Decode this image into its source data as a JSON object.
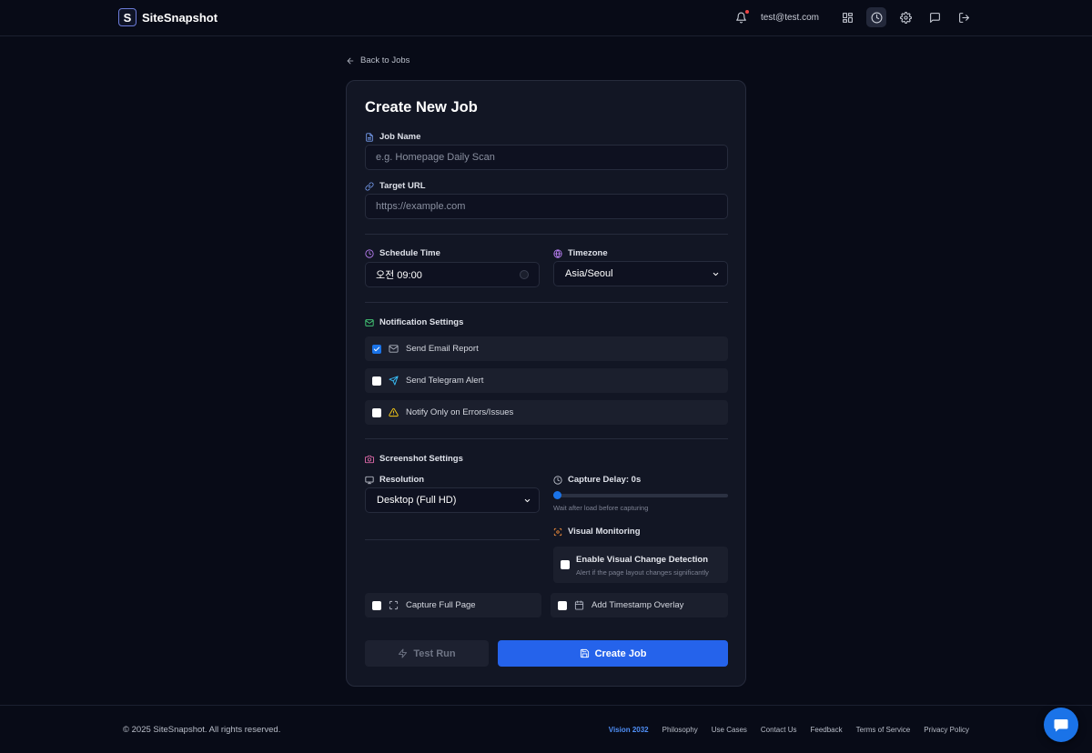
{
  "header": {
    "brand_letter": "S",
    "brand_name": "SiteSnapshot",
    "user_email": "test@test.com"
  },
  "back_link": "Back to Jobs",
  "form": {
    "title": "Create New Job",
    "job_name": {
      "label": "Job Name",
      "placeholder": "e.g. Homepage Daily Scan"
    },
    "target_url": {
      "label": "Target URL",
      "placeholder": "https://example.com"
    },
    "schedule_time": {
      "label": "Schedule Time",
      "value": "오전 09:00"
    },
    "timezone": {
      "label": "Timezone",
      "value": "Asia/Seoul"
    },
    "notifications": {
      "label": "Notification Settings",
      "options": [
        {
          "label": "Send Email Report",
          "checked": true
        },
        {
          "label": "Send Telegram Alert",
          "checked": false
        },
        {
          "label": "Notify Only on Errors/Issues",
          "checked": false
        }
      ]
    },
    "screenshot": {
      "label": "Screenshot Settings",
      "resolution_label": "Resolution",
      "resolution_value": "Desktop (Full HD)",
      "capture_delay_label": "Capture Delay: 0s",
      "capture_delay_seconds": 0,
      "capture_delay_hint": "Wait after load before capturing",
      "visual_monitoring_label": "Visual Monitoring",
      "visual_change_title": "Enable Visual Change Detection",
      "visual_change_sub": "Alert if the page layout changes significantly",
      "visual_change_checked": false,
      "capture_full_page": "Capture Full Page",
      "capture_full_page_checked": false,
      "timestamp_overlay": "Add Timestamp Overlay",
      "timestamp_overlay_checked": false
    },
    "test_run_label": "Test Run",
    "create_job_label": "Create Job"
  },
  "footer": {
    "copyright": "© 2025 SiteSnapshot. All rights reserved.",
    "links": [
      "Vision 2032",
      "Philosophy",
      "Use Cases",
      "Contact Us",
      "Feedback",
      "Terms of Service",
      "Privacy Policy"
    ]
  },
  "colors": {
    "accent": "#2563eb",
    "background": "#080b17",
    "card": "#121624"
  }
}
